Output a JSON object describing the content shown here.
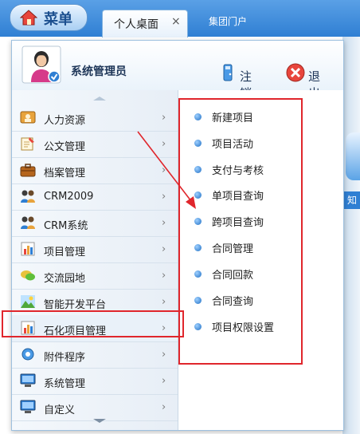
{
  "menu": {
    "label": "菜单"
  },
  "tabs": [
    {
      "label": "个人桌面",
      "close": "×"
    },
    {
      "label": "集团门户"
    }
  ],
  "right_strip": {
    "text": "知"
  },
  "user": {
    "name": "系统管理员"
  },
  "actions": {
    "logout": "注销",
    "exit": "退出"
  },
  "left_menu": [
    {
      "label": "人力资源",
      "icon": "people-icon",
      "arrow": "›"
    },
    {
      "label": "公文管理",
      "icon": "document-pin-icon",
      "arrow": "›"
    },
    {
      "label": "档案管理",
      "icon": "briefcase-icon",
      "arrow": "›"
    },
    {
      "label": "CRM2009",
      "icon": "users-group-icon",
      "arrow": "›"
    },
    {
      "label": "CRM系统",
      "icon": "users-group-icon",
      "arrow": "›"
    },
    {
      "label": "项目管理",
      "icon": "bar-chart-icon",
      "arrow": "›"
    },
    {
      "label": "交流园地",
      "icon": "chat-icon",
      "arrow": "›"
    },
    {
      "label": "智能开发平台",
      "icon": "landscape-icon",
      "arrow": "›"
    },
    {
      "label": "石化项目管理",
      "icon": "bar-chart-icon",
      "arrow": "›"
    },
    {
      "label": "附件程序",
      "icon": "gear-icon",
      "arrow": "›"
    },
    {
      "label": "系统管理",
      "icon": "monitor-icon",
      "arrow": "›"
    },
    {
      "label": "自定义",
      "icon": "monitor-icon",
      "arrow": "›"
    }
  ],
  "submenu": [
    {
      "label": "新建项目"
    },
    {
      "label": "项目活动"
    },
    {
      "label": "支付与考核"
    },
    {
      "label": "单项目查询"
    },
    {
      "label": "跨项目查询"
    },
    {
      "label": "合同管理"
    },
    {
      "label": "合同回款"
    },
    {
      "label": "合同查询"
    },
    {
      "label": "项目权限设置"
    }
  ],
  "colors": {
    "accent": "#2f7fd3",
    "highlight": "#e0262c"
  }
}
